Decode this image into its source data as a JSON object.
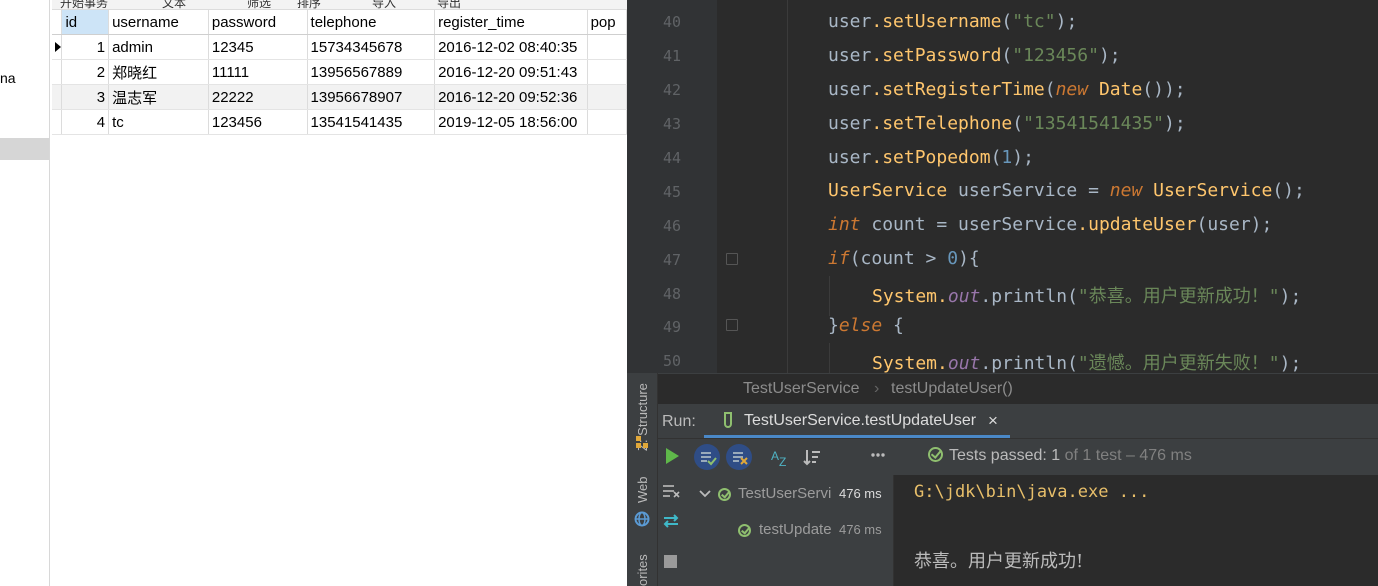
{
  "db": {
    "sidebar_fragment": "na",
    "toolbar": [
      "开始事务",
      "文本",
      "筛选",
      "排序",
      "导入",
      "导出"
    ],
    "columns": [
      "id",
      "username",
      "password",
      "telephone",
      "register_time",
      "pop"
    ],
    "rows": [
      {
        "id": "1",
        "username": "admin",
        "password": "12345",
        "telephone": "15734345678",
        "register_time": "2016-12-02 08:40:35"
      },
      {
        "id": "2",
        "username": "郑晓红",
        "password": "11111",
        "telephone": "13956567889",
        "register_time": "2016-12-20 09:51:43"
      },
      {
        "id": "3",
        "username": "温志军",
        "password": "22222",
        "telephone": "13956678907",
        "register_time": "2016-12-20 09:52:36"
      },
      {
        "id": "4",
        "username": "tc",
        "password": "123456",
        "telephone": "13541541435",
        "register_time": "2019-12-05 18:56:00"
      }
    ]
  },
  "editor": {
    "line_numbers": [
      "40",
      "41",
      "42",
      "43",
      "44",
      "45",
      "46",
      "47",
      "48",
      "49",
      "50"
    ],
    "lines": {
      "l40": {
        "a": "user",
        "b": ".setUsername",
        "c": "(",
        "d": "\"tc\"",
        "e": ");"
      },
      "l41": {
        "a": "user",
        "b": ".setPassword",
        "c": "(",
        "d": "\"123456\"",
        "e": ");"
      },
      "l42": {
        "a": "user",
        "b": ".setRegisterTime",
        "c": "(",
        "d": "new",
        "e": " Date",
        "f": "());"
      },
      "l43": {
        "a": "user",
        "b": ".setTelephone",
        "c": "(",
        "d": "\"13541541435\"",
        "e": ");"
      },
      "l44": {
        "a": "user",
        "b": ".setPopedom",
        "c": "(",
        "d": "1",
        "e": ");"
      },
      "l45": {
        "a": "UserService",
        "b": " userService = ",
        "c": "new",
        "d": " UserService",
        "e": "();"
      },
      "l46": {
        "a": "int",
        "b": " count = userService",
        "c": ".updateUser",
        "d": "(user);"
      },
      "l47": {
        "a": "if",
        "b": "(count > ",
        "c": "0",
        "d": "){"
      },
      "l48": {
        "a": "System.",
        "b": "out",
        "c": ".println(",
        "d": "\"恭喜。用户更新成功！\"",
        "e": ");"
      },
      "l49": {
        "a": "}",
        "b": "else",
        "c": " {"
      },
      "l50": {
        "a": "System.",
        "b": "out",
        "c": ".println(",
        "d": "\"遗憾。用户更新失败！\"",
        "e": ");"
      }
    },
    "breadcrumb": {
      "class": "TestUserService",
      "sep": "›",
      "method": "testUpdateUser()"
    }
  },
  "tool_strip": {
    "structure": "Z: Structure",
    "web": "Web",
    "favorites": "orites"
  },
  "run": {
    "label": "Run:",
    "tab_name": "TestUserService.testUpdateUser",
    "tab_close": "×",
    "status": {
      "passed": "Tests passed: ",
      "count": "1",
      "rest": " of 1 test – 476 ms"
    },
    "tree": [
      {
        "name": "TestUserServi",
        "time": "476 ms"
      },
      {
        "name": "testUpdate",
        "time": "476 ms"
      }
    ],
    "console": {
      "command": "G:\\jdk\\bin\\java.exe ...",
      "output": "恭喜。用户更新成功!"
    }
  },
  "colors": {
    "accent": "#4a88c7",
    "pass_green": "#8fbf6f",
    "ide_bg": "#2b2b2b",
    "panel_bg": "#3c3f41"
  }
}
